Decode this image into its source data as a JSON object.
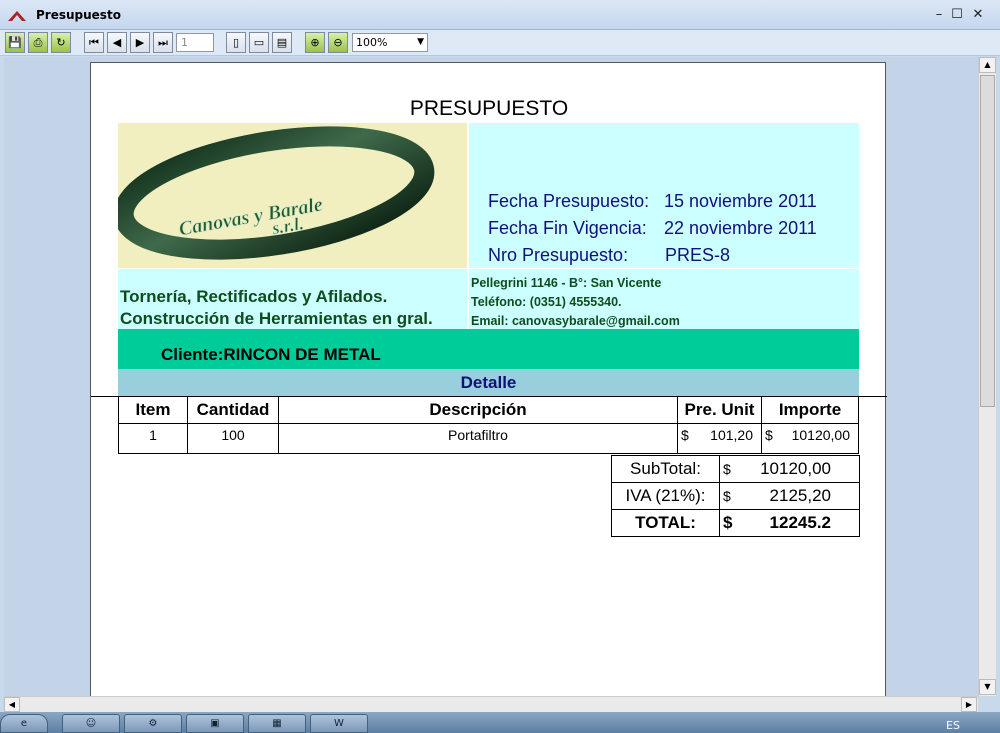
{
  "window": {
    "title": "Presupuesto",
    "minimize": "–",
    "maximize": "☐",
    "close": "✕"
  },
  "toolbar": {
    "save": "💾",
    "print": "⎙",
    "refresh": "↻",
    "first": "⏮",
    "prev": "◀",
    "next": "▶",
    "last": "⏭",
    "page_value": "1",
    "page_single": "▯",
    "page_width": "▭",
    "page_whole": "▤",
    "zoom_in": "⊕",
    "zoom_out": "⊖",
    "zoom_value": "100%"
  },
  "report": {
    "title": "PRESUPUESTO",
    "logo": {
      "line1": "Canovas y Barale",
      "line2": "s.r.l."
    },
    "fecha_label": "Fecha Presupuesto:",
    "fecha_value": "15 noviembre 2011",
    "vigencia_label": "Fecha Fin Vigencia:",
    "vigencia_value": "22 noviembre 2011",
    "nro_label": "Nro Presupuesto:",
    "nro_value": "PRES-8",
    "tagline1": "Tornería, Rectificados y Afilados.",
    "tagline2": "Construcción de Herramientas en gral.",
    "address": "Pellegrini 1146 - B°: San Vicente",
    "phone": "Teléfono: (0351) 4555340.",
    "email": "Email: canovasybarale@gmail.com",
    "cliente": "Cliente:RINCON DE METAL",
    "detalle": "Detalle",
    "columns": {
      "item": "Item",
      "cantidad": "Cantidad",
      "descripcion": "Descripción",
      "pre_unit": "Pre. Unit",
      "importe": "Importe"
    },
    "rows": [
      {
        "item": "1",
        "cantidad": "100",
        "descripcion": "Portafiltro",
        "currency": "$",
        "pre_unit": "101,20",
        "importe": "10120,00"
      }
    ],
    "subtotal_label": "SubTotal:",
    "subtotal_value": "10120,00",
    "iva_label": "IVA (21%):",
    "iva_value": "2125,20",
    "total_label": "TOTAL:",
    "total_value": "12245.2",
    "currency": "$"
  },
  "taskbar": {
    "lang": "ES"
  },
  "colors": {
    "info_bg": "#ccffff",
    "logo_bg": "#f1efc0",
    "client_bar": "#00cc99",
    "detalle_bar": "#99cedc",
    "text_blue": "#10107a",
    "text_green": "#0d4d1d"
  }
}
